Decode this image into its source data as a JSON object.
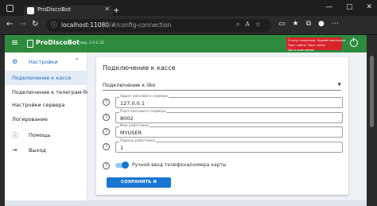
{
  "browser": {
    "tab_title": "ProDiscoBot",
    "tab_close": "✕",
    "new_tab": "+",
    "url_host": "localhost:11080",
    "url_path": "/#/config-connection",
    "window_controls": [
      "—",
      "▢",
      "✕"
    ]
  },
  "header": {
    "title": "ProDiscoBot",
    "version": "вер. 2.0.2.32",
    "license_lines": [
      "Статус лицензии: Недействительна",
      "Порт сайта: Порт сайта",
      "Дата окончания:"
    ]
  },
  "sidebar": {
    "items": [
      {
        "label": "Настройки",
        "icon": "gear-icon"
      },
      {
        "label": "Подключение к кассе",
        "active": true
      },
      {
        "label": "Подключение к телеграм-боту"
      },
      {
        "label": "Настройки сервера"
      },
      {
        "label": "Логирование"
      },
      {
        "label": "Помощь",
        "icon": "help-icon"
      },
      {
        "label": "Выход",
        "icon": "logout-icon"
      }
    ]
  },
  "main": {
    "title": "Подключение к кассе",
    "connection_select": "Подключение к iiko",
    "fields": [
      {
        "label": "Адрес кассового сервера",
        "value": "127.0.0.1"
      },
      {
        "label": "Порт кассового сервера",
        "value": "8002"
      },
      {
        "label": "Имя работника",
        "value": "MYUSER"
      },
      {
        "label": "Пароль работника",
        "value": "1"
      }
    ],
    "toggle_label": "Ручной ввод телефона/номера карты",
    "toggle_on": true,
    "save_button": "СОХРАНИТЬ И ПРОВЕРИТЬ"
  },
  "colors": {
    "header_bg": "#2e8b3e",
    "license_bg": "#d8232a",
    "primary": "#1976d2",
    "active_item_bg": "#e3ebf7"
  }
}
